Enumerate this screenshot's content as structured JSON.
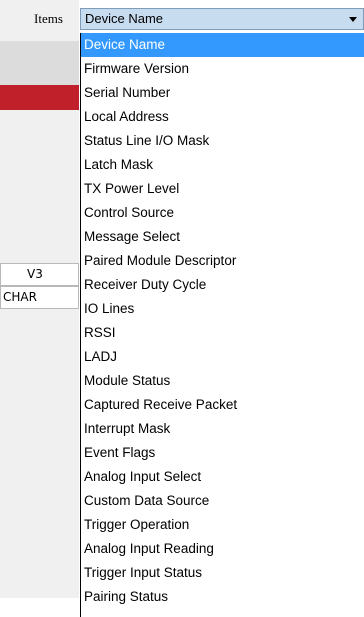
{
  "items_label": "Items",
  "combo": {
    "selected_value": "Device Name"
  },
  "left_cells": [
    "V3",
    "CHAR"
  ],
  "dropdown_options": [
    "Device Name",
    "Firmware Version",
    "Serial Number",
    "Local Address",
    "Status Line I/O Mask",
    "Latch Mask",
    "TX Power Level",
    "Control Source",
    "Message Select",
    "Paired Module Descriptor",
    "Receiver Duty Cycle",
    "IO Lines",
    "RSSI",
    "LADJ",
    "Module Status",
    "Captured Receive Packet",
    "Interrupt Mask",
    "Event Flags",
    "Analog Input Select",
    "Custom Data Source",
    "Trigger Operation",
    "Analog Input Reading",
    "Trigger Input Status",
    "Pairing Status"
  ],
  "colors": {
    "highlight": "#3399ff",
    "combo_bg": "#c8dcef",
    "red_bar": "#c0202a"
  }
}
